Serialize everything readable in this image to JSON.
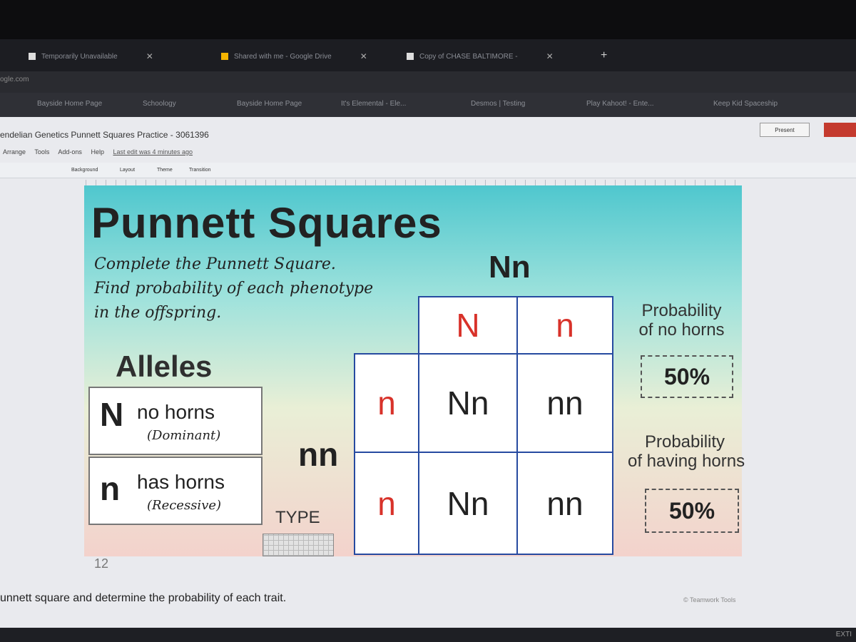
{
  "browser": {
    "tabs": [
      {
        "label": "Temporarily Unavailable"
      },
      {
        "label": "Shared with me - Google Drive"
      },
      {
        "label": "Copy of CHASE BALTIMORE -"
      }
    ],
    "address": "ogle.com",
    "bookmarks": [
      "Bayside Home Page",
      "Schoology",
      "Bayside Home Page",
      "It's Elemental - Ele...",
      "Desmos | Testing",
      "Play Kahoot! - Ente...",
      "Keep Kid Spaceship"
    ]
  },
  "docs": {
    "title": "endelian Genetics Punnett Squares Practice - 3061396",
    "menu": [
      "Arrange",
      "Tools",
      "Add-ons",
      "Help"
    ],
    "last_edit": "Last edit was 4 minutes ago",
    "present_label": "Present",
    "toolbar": [
      "Background",
      "Layout",
      "Theme",
      "Transition"
    ]
  },
  "slide": {
    "title": "Punnett Squares",
    "instructions": [
      "Complete the Punnett Square.",
      "Find probability of each phenotype",
      "in the offspring."
    ],
    "parent_top": "Nn",
    "parent_side": "nn",
    "alleles_heading": "Alleles",
    "alleles": [
      {
        "letter": "N",
        "trait": "no horns",
        "type": "(Dominant)"
      },
      {
        "letter": "n",
        "trait": "has horns",
        "type": "(Recessive)"
      }
    ],
    "type_label": "TYPE",
    "grid": {
      "col_headers": [
        "N",
        "n"
      ],
      "row_headers": [
        "n",
        "n"
      ],
      "cells": [
        [
          "Nn",
          "nn"
        ],
        [
          "Nn",
          "nn"
        ]
      ]
    },
    "probabilities": [
      {
        "label_line1": "Probability",
        "label_line2": "of no horns",
        "value": "50%"
      },
      {
        "label_line1": "Probability",
        "label_line2": "of having horns",
        "value": "50%"
      }
    ],
    "page_number": "12",
    "watermark": "© Teamwork Tools"
  },
  "notes": "unnett square and determine the probability of each trait.",
  "bottom_right": "EXTI",
  "colors": {
    "grid_border": "#264aa0",
    "header_letters": "#d8322a"
  }
}
